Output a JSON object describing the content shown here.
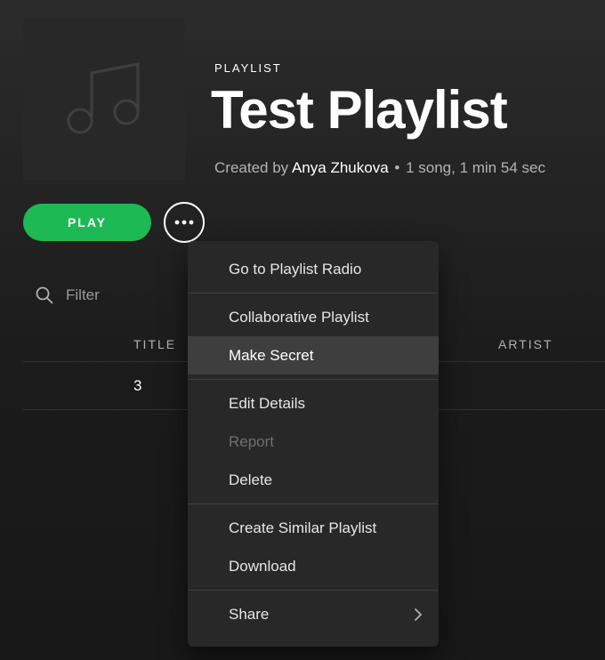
{
  "playlist": {
    "type_label": "PLAYLIST",
    "title": "Test Playlist",
    "created_by_prefix": "Created by",
    "owner": "Anya Zhukova",
    "separator": "•",
    "summary": "1 song, 1 min 54 sec",
    "cover_icon": "music-note-icon"
  },
  "actions": {
    "play_label": "PLAY",
    "more_icon": "more-options-icon"
  },
  "filter": {
    "placeholder": "Filter",
    "value": "",
    "icon": "search-icon"
  },
  "table": {
    "columns": [
      "TITLE",
      "ARTIST"
    ],
    "rows": [
      {
        "title": "3",
        "artist": ""
      }
    ]
  },
  "context_menu": {
    "groups": [
      [
        {
          "label": "Go to Playlist Radio"
        }
      ],
      [
        {
          "label": "Collaborative Playlist"
        },
        {
          "label": "Make Secret",
          "highlighted": true
        }
      ],
      [
        {
          "label": "Edit Details"
        },
        {
          "label": "Report",
          "disabled": true
        },
        {
          "label": "Delete"
        }
      ],
      [
        {
          "label": "Create Similar Playlist"
        },
        {
          "label": "Download"
        }
      ],
      [
        {
          "label": "Share",
          "submenu_icon": "chevron-right-icon"
        }
      ]
    ]
  },
  "colors": {
    "accent": "#1db954",
    "background": "#181818",
    "menu_background": "#282828",
    "menu_highlight": "#3e3e3e",
    "text_secondary": "#b3b3b3",
    "text_disabled": "#6f6f6f"
  }
}
